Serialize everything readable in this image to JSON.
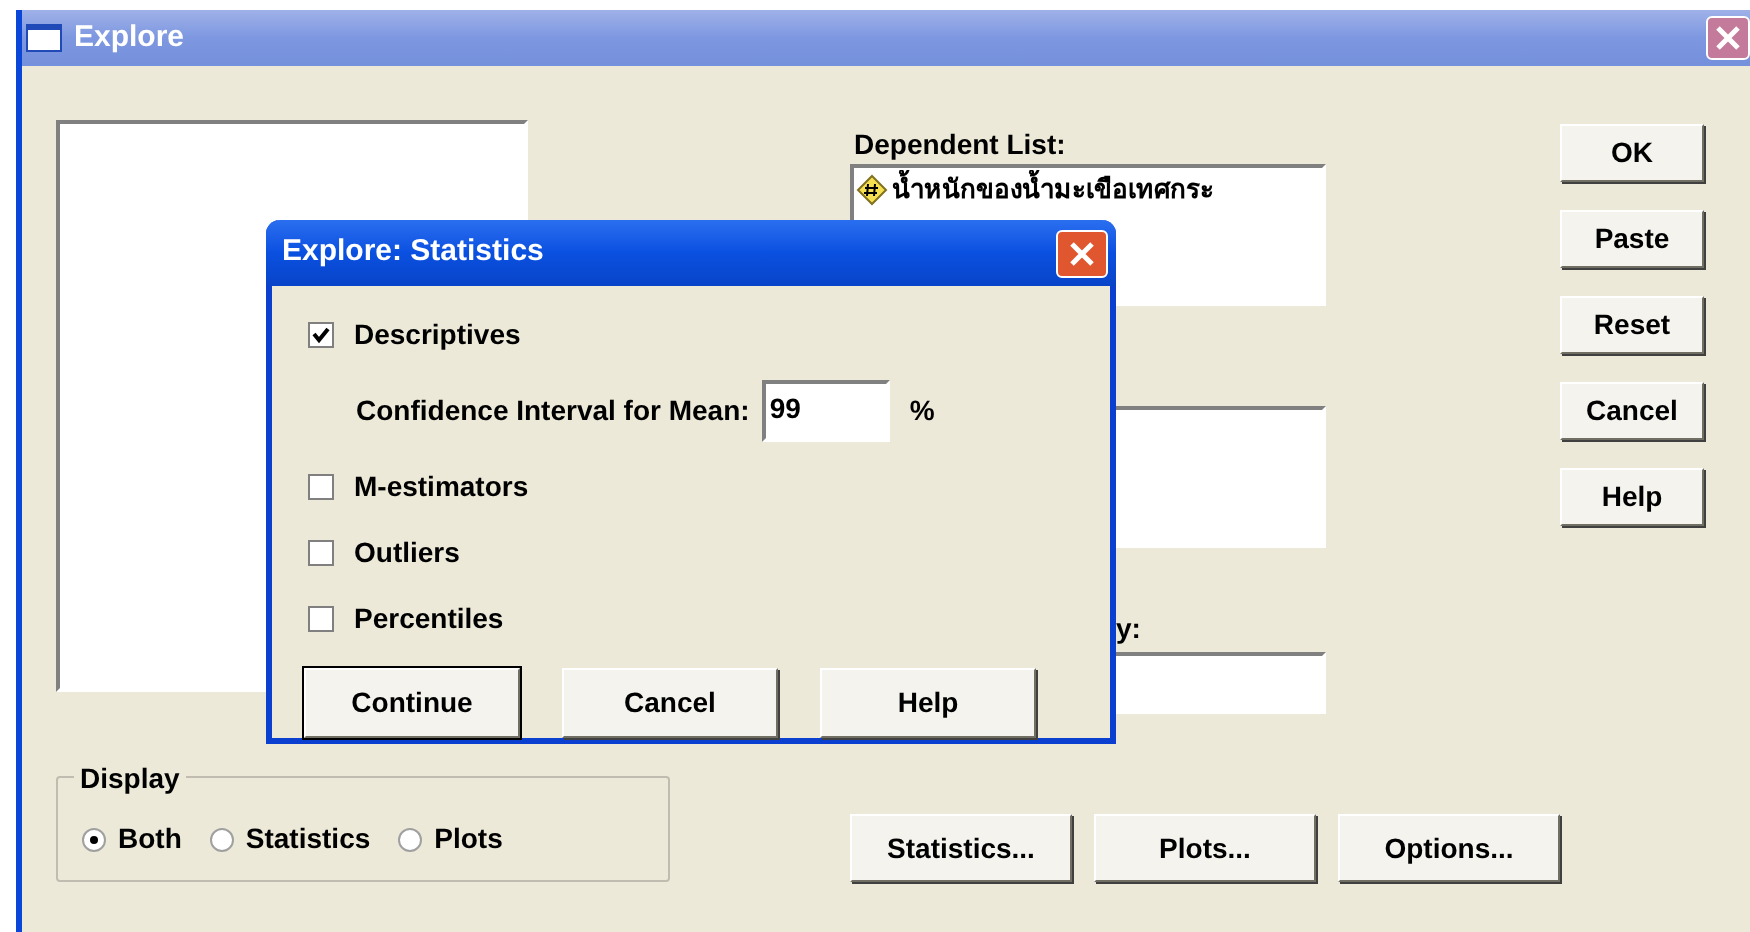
{
  "window": {
    "title": "Explore"
  },
  "dependent_list": {
    "label": "Dependent List:",
    "items": [
      {
        "text": "น้ำหนักของน้ำมะเขือเทศกระ"
      }
    ]
  },
  "label_cases": {
    "label": "y:"
  },
  "buttons": [
    "OK",
    "Paste",
    "Reset",
    "Cancel",
    "Help"
  ],
  "display": {
    "label": "Display",
    "options": [
      {
        "label": "Both",
        "selected": true
      },
      {
        "label": "Statistics",
        "selected": false
      },
      {
        "label": "Plots",
        "selected": false
      }
    ]
  },
  "bottom_buttons": [
    "Statistics...",
    "Plots...",
    "Options..."
  ],
  "dialog": {
    "title": "Explore: Statistics",
    "options": [
      {
        "kind": "checkbox",
        "label": "Descriptives",
        "checked": true
      },
      {
        "kind": "field",
        "label": "Confidence Interval for Mean:",
        "value": "99",
        "suffix": "%"
      },
      {
        "kind": "checkbox",
        "label": "M-estimators",
        "checked": false
      },
      {
        "kind": "checkbox",
        "label": "Outliers",
        "checked": false
      },
      {
        "kind": "checkbox",
        "label": "Percentiles",
        "checked": false
      }
    ],
    "buttons": [
      {
        "label": "Continue",
        "default": true
      },
      {
        "label": "Cancel",
        "default": false
      },
      {
        "label": "Help",
        "default": false
      }
    ]
  }
}
